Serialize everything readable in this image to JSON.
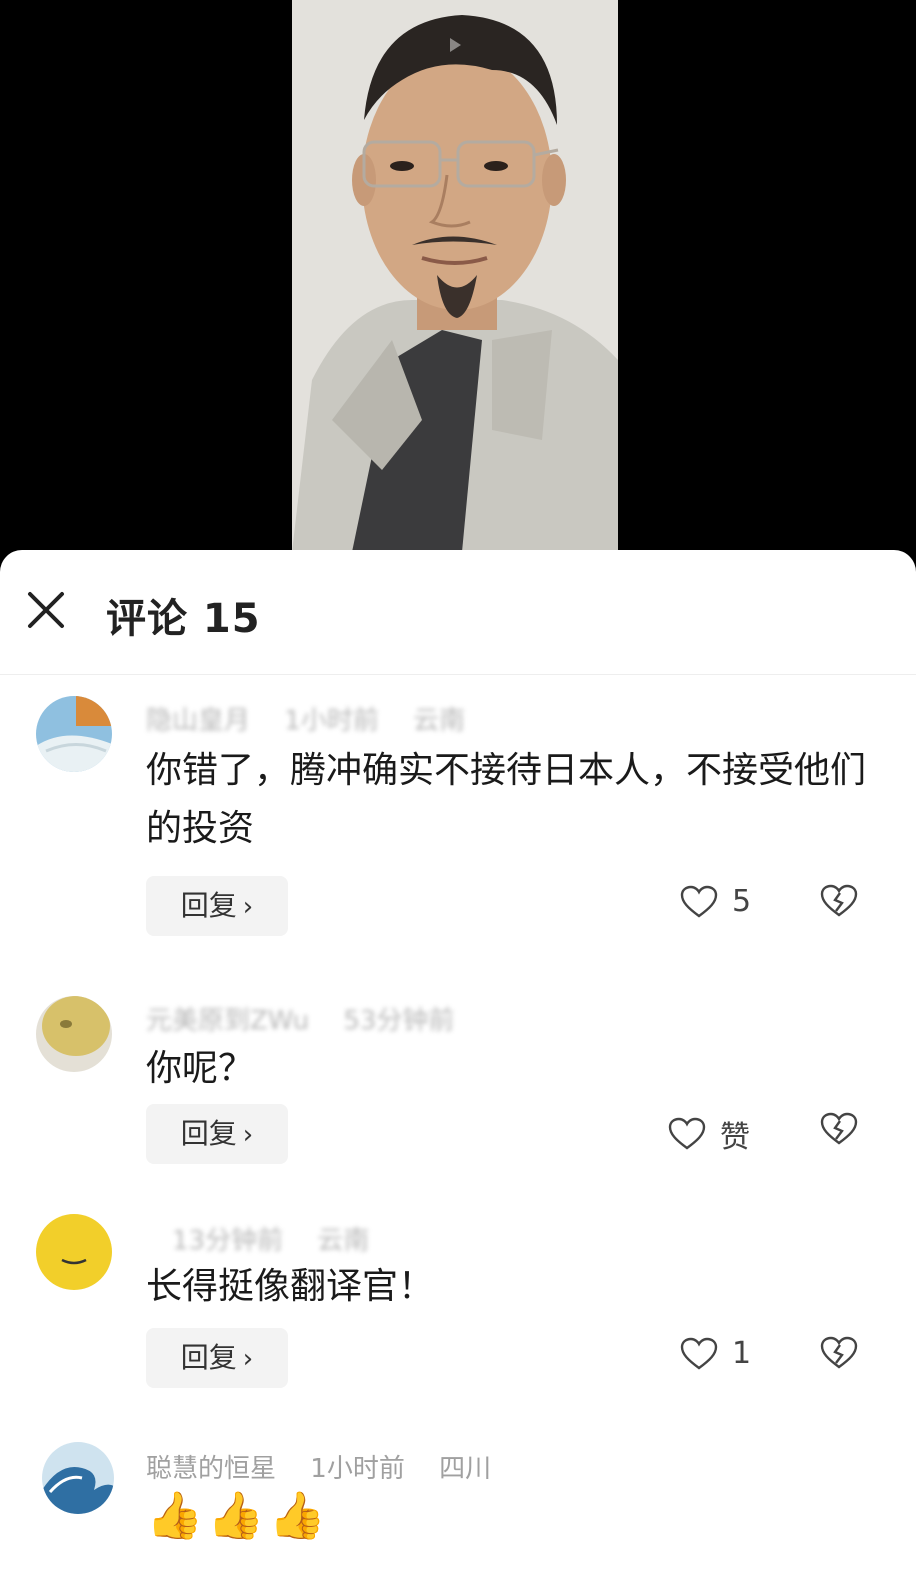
{
  "sheet": {
    "title": "评论 15"
  },
  "comments": [
    {
      "username": "隐山皇月",
      "time": "1小时前",
      "location": "云南",
      "text": "你错了，腾冲确实不接待日本人，不接受他们的投资",
      "reply_label": "回复",
      "like_count": "5"
    },
    {
      "username": "元美原到ZWu",
      "time": "53分钟前",
      "location": "",
      "text": "你呢？",
      "reply_label": "回复",
      "like_count": "赞"
    },
    {
      "username": "",
      "time": "13分钟前",
      "location": "云南",
      "text": "长得挺像翻译官！",
      "reply_label": "回复",
      "like_count": "1"
    },
    {
      "username": "聪慧的恒星",
      "time": "1小时前",
      "location": "四川",
      "text": "👍👍👍"
    }
  ],
  "colors": {
    "meta": "#a0a0a0",
    "text": "#1a1a1a",
    "reply_bg": "#f3f3f3"
  },
  "icons": [
    "close-icon",
    "heart-icon",
    "broken-heart-icon",
    "chevron-right-icon",
    "play-icon"
  ]
}
